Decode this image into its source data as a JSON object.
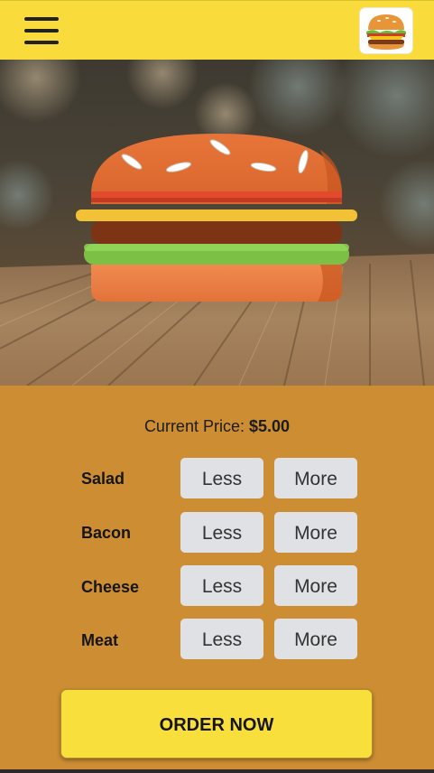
{
  "header": {
    "menu_icon": "hamburger-menu-icon",
    "logo_icon": "burger-logo-icon"
  },
  "hero": {
    "image": "burger-on-wooden-table"
  },
  "price": {
    "label": "Current Price:",
    "value": "$5.00"
  },
  "ingredients": [
    {
      "name": "Salad",
      "less_label": "Less",
      "more_label": "More"
    },
    {
      "name": "Bacon",
      "less_label": "Less",
      "more_label": "More"
    },
    {
      "name": "Cheese",
      "less_label": "Less",
      "more_label": "More"
    },
    {
      "name": "Meat",
      "less_label": "Less",
      "more_label": "More"
    }
  ],
  "order_button": {
    "label": "ORDER NOW"
  },
  "colors": {
    "header_bg": "#f9dc3c",
    "panel_bg": "#cd8d33",
    "button_bg": "#dfe1e5",
    "order_bg": "#f9df3c"
  }
}
